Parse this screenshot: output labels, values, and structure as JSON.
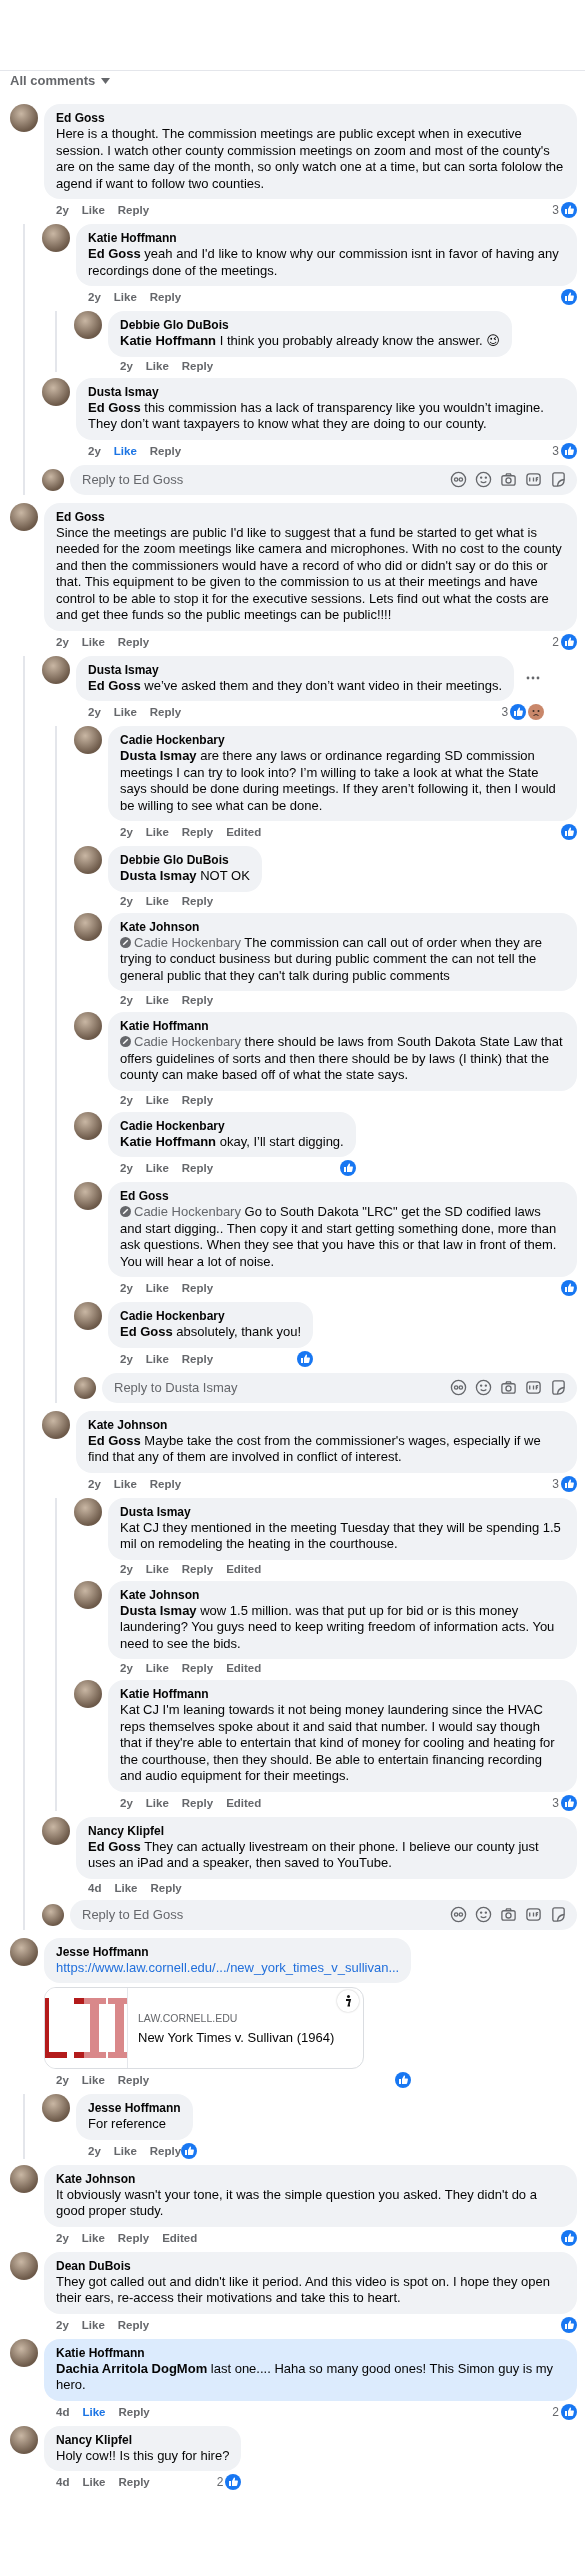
{
  "header": {
    "label": "All comments"
  },
  "comments": [
    {
      "kind": "comment",
      "author": "Ed Goss",
      "text": "Here is a thought. The commission meetings are public except when in executive session. I watch other county commission meetings on zoom and most of the county's are on the same day of the month, so only watch one at a time, but can sorta fololow the agend if want to follow two counties.",
      "time": "2y",
      "like": "Like",
      "reply": "Reply",
      "liked": false,
      "reaction_count": "3",
      "reactions": [
        {
          "kind": "like"
        }
      ],
      "children": [
        {
          "kind": "comment",
          "author": "Katie Hoffmann",
          "text": "**Ed Goss** yeah and I'd like to know why our commission isnt in favor of having any recordings done of the meetings.",
          "time": "2y",
          "like": "Like",
          "reply": "Reply",
          "liked": false,
          "reactions": [
            {
              "kind": "like"
            }
          ],
          "children": [
            {
              "kind": "comment",
              "author": "Debbie Glo DuBois",
              "text": "**Katie Hoffmann** I think you probably already know the answer. 😉",
              "time": "2y",
              "like": "Like",
              "reply": "Reply",
              "liked": false
            }
          ]
        },
        {
          "kind": "comment",
          "author": "Dusta Ismay",
          "text": "**Ed Goss** this commission has a lack of transparency like you wouldn’t imagine. They don’t want taxpayers to know what they are doing to our county.",
          "time": "2y",
          "like": "Like",
          "reply": "Reply",
          "liked": true,
          "reaction_count": "3",
          "reactions": [
            {
              "kind": "like"
            }
          ]
        },
        {
          "kind": "reply_box",
          "placeholder": "Reply to Ed Goss"
        }
      ]
    },
    {
      "kind": "comment",
      "author": "Ed Goss",
      "text": "Since the meetings are public I'd like to suggest that a fund be started to get what is needed for the zoom meetings like camera and microphones. With no cost to the county and then the commissioners would have a record of who did or didn't say or do this or that. This equipment to be given to the commission to us at their meetings and have control to be able to stop it for the executive sessions. Lets find out what the costs are and get thee funds so the public meetings can be public!!!!",
      "time": "2y",
      "like": "Like",
      "reply": "Reply",
      "liked": false,
      "reaction_count": "2",
      "reactions": [
        {
          "kind": "like"
        }
      ],
      "children": [
        {
          "kind": "comment",
          "author": "Dusta Ismay",
          "text": "**Ed Goss** we’ve asked them and they don’t want video in their meetings.",
          "time": "2y",
          "like": "Like",
          "reply": "Reply",
          "liked": false,
          "more": true,
          "reaction_count": "3",
          "reactions": [
            {
              "kind": "like"
            },
            {
              "kind": "sad"
            }
          ],
          "children": [
            {
              "kind": "comment",
              "author": "Cadie Hockenbary",
              "text": "**Dusta Ismay** are there any laws or ordinance regarding SD commission meetings I can try to look into? I’m willing to take a look at what the State says should be done during meetings. If they aren’t following it, then I would be willing to see what can be done.",
              "time": "2y",
              "like": "Like",
              "reply": "Reply",
              "edited": "Edited",
              "liked": false,
              "reactions": [
                {
                  "kind": "like"
                }
              ]
            },
            {
              "kind": "comment",
              "author": "Debbie Glo DuBois",
              "text": "**Dusta Ismay** NOT OK",
              "time": "2y",
              "like": "Like",
              "reply": "Reply",
              "liked": false
            },
            {
              "kind": "comment",
              "author": "Kate Johnson",
              "tag": "Cadie Hockenbary",
              "text": "The commission can call out of order when they are trying to conduct business but during public comment the can not tell the general public that they can't talk during public comments",
              "time": "2y",
              "like": "Like",
              "reply": "Reply",
              "liked": false
            },
            {
              "kind": "comment",
              "author": "Katie Hoffmann",
              "tag": "Cadie Hockenbary",
              "text": "there should be laws from South Dakota State Law that offers guidelines of sorts and then there should be by laws (I think) that the county can make based off of what the state says.",
              "time": "2y",
              "like": "Like",
              "reply": "Reply",
              "liked": false
            },
            {
              "kind": "comment",
              "author": "Cadie Hockenbary",
              "text": "**Katie Hoffmann** okay, I’ll start digging.",
              "time": "2y",
              "like": "Like",
              "reply": "Reply",
              "liked": false,
              "reactions": [
                {
                  "kind": "like"
                }
              ]
            },
            {
              "kind": "comment",
              "author": "Ed Goss",
              "tag": "Cadie Hockenbary",
              "text": "Go to South Dakota \"LRC\" get the SD codified laws and start digging.. Then copy it and start getting something done, more than ask questions. When they see that you have this or that law in front of them. You will hear a lot of noise.",
              "time": "2y",
              "like": "Like",
              "reply": "Reply",
              "liked": false,
              "reactions": [
                {
                  "kind": "like"
                }
              ]
            },
            {
              "kind": "comment",
              "author": "Cadie Hockenbary",
              "text": "**Ed Goss** absolutely, thank you!",
              "time": "2y",
              "like": "Like",
              "reply": "Reply",
              "liked": false,
              "reactions": [
                {
                  "kind": "like"
                }
              ]
            },
            {
              "kind": "reply_box",
              "placeholder": "Reply to Dusta Ismay"
            }
          ]
        },
        {
          "kind": "comment",
          "author": "Kate Johnson",
          "text": "**Ed Goss** Maybe take the cost from the commissioner's wages, especially if we find that any of them are involved in conflict of interest.",
          "time": "2y",
          "like": "Like",
          "reply": "Reply",
          "liked": false,
          "reaction_count": "3",
          "reactions": [
            {
              "kind": "like"
            }
          ],
          "children": [
            {
              "kind": "comment",
              "author": "Dusta Ismay",
              "text": "Kat CJ they mentioned in the meeting Tuesday that they will be spending 1.5 mil on remodeling the heating in the courthouse.",
              "time": "2y",
              "like": "Like",
              "reply": "Reply",
              "edited": "Edited",
              "liked": false
            },
            {
              "kind": "comment",
              "author": "Kate Johnson",
              "text": "**Dusta Ismay** wow 1.5 million. was that put up for bid or is this money laundering? You guys need to keep writing freedom of information acts. You need to see the bids.",
              "time": "2y",
              "like": "Like",
              "reply": "Reply",
              "edited": "Edited",
              "liked": false
            },
            {
              "kind": "comment",
              "author": "Katie Hoffmann",
              "text": "Kat CJ I'm leaning towards it not being money laundering since the HVAC reps themselves spoke about it and said that number. I would say though that if they're able to entertain that kind of money for cooling and heating for the courthouse, then they should. Be able to entertain financing recording and audio equipment for their meetings.",
              "time": "2y",
              "like": "Like",
              "reply": "Reply",
              "edited": "Edited",
              "liked": false,
              "reaction_count": "3",
              "reactions": [
                {
                  "kind": "like"
                }
              ]
            }
          ]
        },
        {
          "kind": "comment",
          "author": "Nancy Klipfel",
          "text": "**Ed Goss** They can actually livestream on their phone. I believe our county just uses an iPad and a speaker, then saved to YouTube.",
          "time": "4d",
          "like": "Like",
          "reply": "Reply",
          "liked": false
        },
        {
          "kind": "reply_box",
          "placeholder": "Reply to Ed Goss"
        }
      ]
    },
    {
      "kind": "comment",
      "author": "Jesse Hoffmann",
      "link": "https://www.law.cornell.edu/.../new_york_times_v_sullivan...",
      "preview": {
        "domain": "LAW.CORNELL.EDU",
        "title": "New York Times v. Sullivan (1964)"
      },
      "time": "2y",
      "like": "Like",
      "reply": "Reply",
      "liked": false,
      "reactions": [
        {
          "kind": "like"
        }
      ],
      "children": [
        {
          "kind": "comment",
          "author": "Jesse Hoffmann",
          "text": "For reference",
          "time": "2y",
          "like": "Like",
          "reply": "Reply",
          "liked": false,
          "reactions": [
            {
              "kind": "like"
            }
          ]
        }
      ]
    },
    {
      "kind": "comment",
      "author": "Kate Johnson",
      "text": "It obviously wasn't your tone, it was the simple question you asked. They didn't do a good proper study.",
      "time": "2y",
      "like": "Like",
      "reply": "Reply",
      "edited": "Edited",
      "liked": false,
      "reactions": [
        {
          "kind": "like"
        }
      ]
    },
    {
      "kind": "comment",
      "author": "Dean DuBois",
      "text": "They got called out and didn't like it period. And this video is spot on. I hope they open their ears, re-access their motivations and take this to heart.",
      "time": "2y",
      "like": "Like",
      "reply": "Reply",
      "liked": false,
      "reactions": [
        {
          "kind": "like"
        }
      ]
    },
    {
      "kind": "comment",
      "author": "Katie Hoffmann",
      "text": "**Dachia Arritola DogMom** last one.... Haha so many good ones! This Simon guy is my hero.",
      "time": "4d",
      "like": "Like",
      "reply": "Reply",
      "liked": true,
      "highlighted": true,
      "reaction_count": "2",
      "reactions": [
        {
          "kind": "like"
        }
      ]
    },
    {
      "kind": "comment",
      "author": "Nancy Klipfel",
      "text": "Holy cow!! Is this guy for hire?",
      "time": "4d",
      "like": "Like",
      "reply": "Reply",
      "liked": false,
      "reaction_count": "2",
      "reactions": [
        {
          "kind": "like"
        }
      ]
    }
  ]
}
